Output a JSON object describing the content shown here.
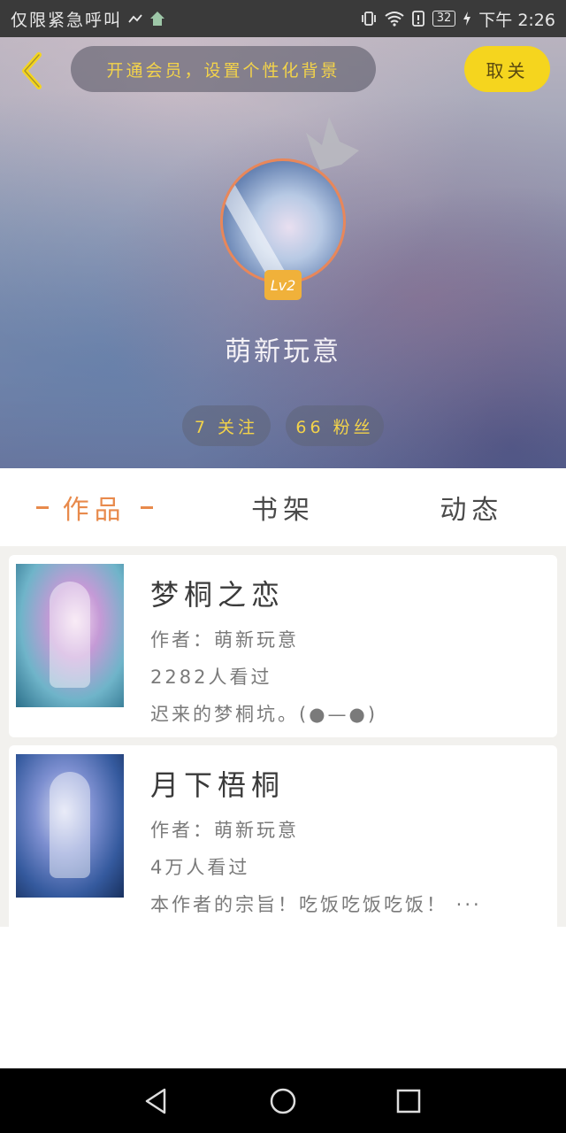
{
  "status_bar": {
    "left_text": "仅限紧急呼叫",
    "battery": "32",
    "time": "下午 2:26"
  },
  "header": {
    "promo_text": "开通会员，设置个性化背景",
    "cancel_label": "取关",
    "level": "Lv2",
    "nickname": "萌新玩意",
    "following": "7 关注",
    "fans": "66 粉丝"
  },
  "tabs": [
    {
      "label": "作品",
      "active": true
    },
    {
      "label": "书架",
      "active": false
    },
    {
      "label": "动态",
      "active": false
    }
  ],
  "works": [
    {
      "title": "梦桐之恋",
      "author": "作者：萌新玩意",
      "views": "2282人看过",
      "desc": "迟来的梦桐坑。(●—●)"
    },
    {
      "title": "月下梧桐",
      "author": "作者：萌新玩意",
      "views": "4万人看过",
      "desc": "本作者的宗旨！吃饭吃饭吃饭！ ···"
    }
  ],
  "colors": {
    "accent": "#e88a4c",
    "promo_text": "#f3d34a",
    "cancel_bg": "#f5d51e",
    "level_bg": "#f0b13a"
  },
  "icons": {
    "back": "back-arrow-icon",
    "crown": "crown-icon",
    "nav_back": "triangle-back-icon",
    "nav_home": "circle-home-icon",
    "nav_recent": "square-recent-icon"
  }
}
